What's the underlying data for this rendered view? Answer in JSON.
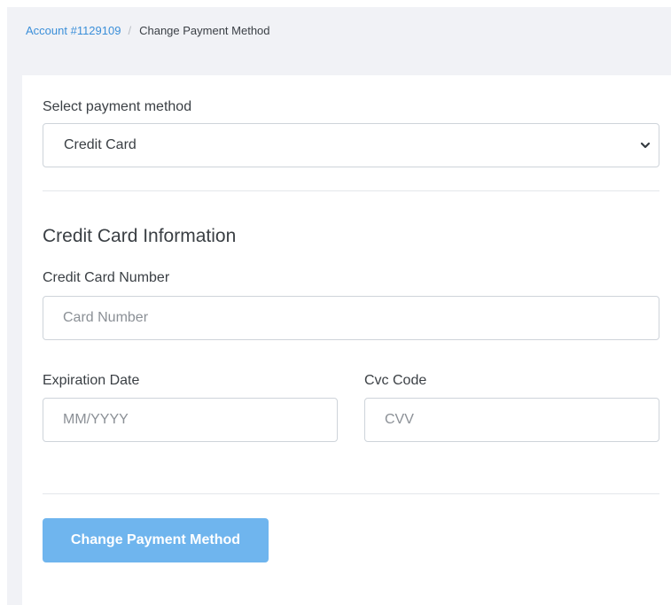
{
  "breadcrumb": {
    "account_link": "Account #1129109",
    "separator": "/",
    "current": "Change Payment Method"
  },
  "payment_method": {
    "label": "Select payment method",
    "selected": "Credit Card"
  },
  "credit_card": {
    "section_title": "Credit Card Information",
    "number_label": "Credit Card Number",
    "number_placeholder": "Card Number",
    "expiration_label": "Expiration Date",
    "expiration_placeholder": "MM/YYYY",
    "cvc_label": "Cvc Code",
    "cvc_placeholder": "CVV"
  },
  "submit_button": {
    "label": "Change Payment Method"
  },
  "colors": {
    "link": "#3b8fd9",
    "button": "#6fb5ee",
    "background": "#f1f2f6"
  },
  "icons": {
    "select_chevron": "chevron-down-icon"
  }
}
